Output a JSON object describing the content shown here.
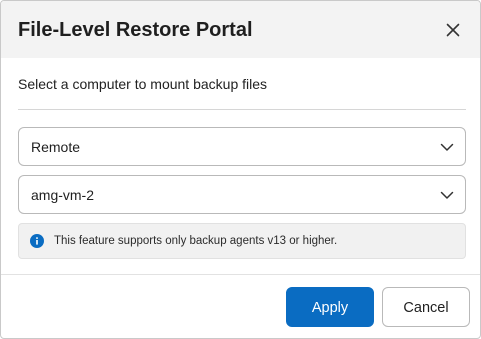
{
  "dialog": {
    "title": "File-Level Restore Portal",
    "subtitle": "Select a computer to mount backup files",
    "close_icon": "close-icon"
  },
  "location_select": {
    "value": "Remote",
    "icon": "chevron-down-icon"
  },
  "computer_select": {
    "value": "amg-vm-2",
    "icon": "chevron-down-icon"
  },
  "info": {
    "icon": "info-icon",
    "text": "This feature supports only backup agents v13 or higher."
  },
  "footer": {
    "apply_label": "Apply",
    "cancel_label": "Cancel"
  },
  "colors": {
    "primary": "#0a6cc2",
    "header_bg": "#f3f3f3",
    "info_bg": "#f1f1f1"
  }
}
